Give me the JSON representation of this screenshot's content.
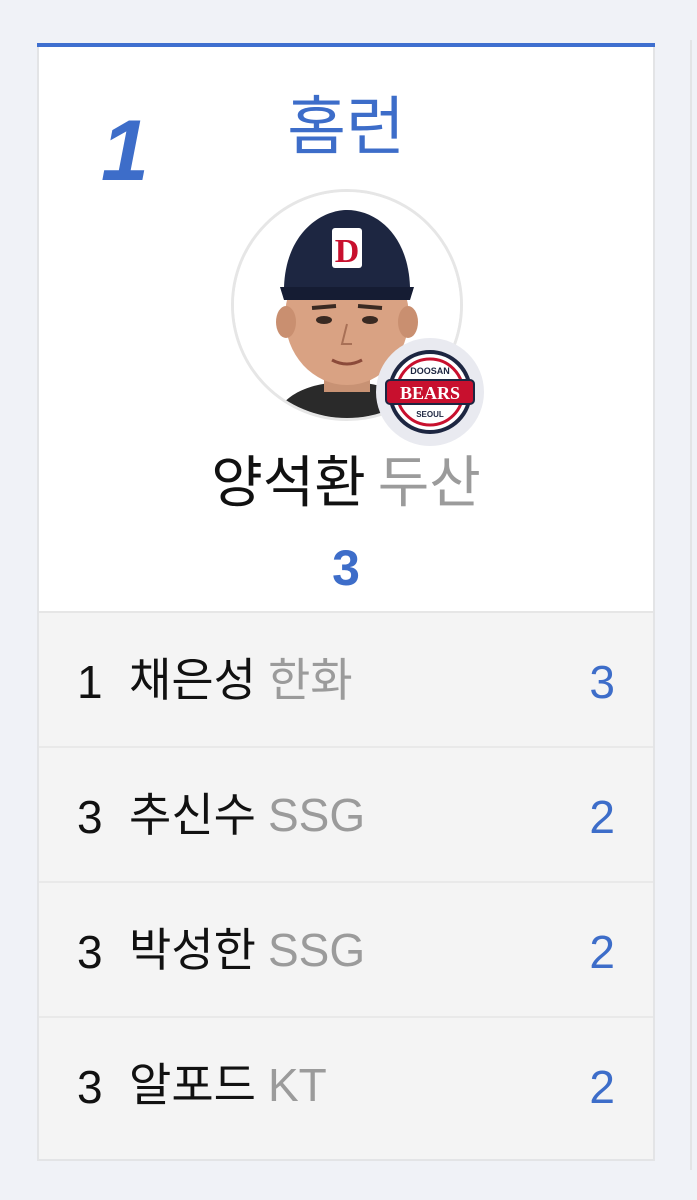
{
  "card": {
    "rank": "1",
    "category": "홈런",
    "leader": {
      "name": "양석환",
      "team": "두산",
      "value": "3",
      "photo_icon": "player-photo",
      "team_logo_icon": "doosan-bears-logo",
      "team_logo_text_top": "DOOSAN",
      "team_logo_text_main": "BEARS",
      "team_logo_text_bottom": "SEOUL"
    },
    "rows": [
      {
        "rank": "1",
        "name": "채은성",
        "team": "한화",
        "value": "3"
      },
      {
        "rank": "3",
        "name": "추신수",
        "team": "SSG",
        "value": "2"
      },
      {
        "rank": "3",
        "name": "박성한",
        "team": "SSG",
        "value": "2"
      },
      {
        "rank": "3",
        "name": "알포드",
        "team": "KT",
        "value": "2"
      }
    ]
  },
  "colors": {
    "accent": "#3d6dc9",
    "muted_text": "#9b9b9b",
    "list_background": "#f4f4f4"
  }
}
